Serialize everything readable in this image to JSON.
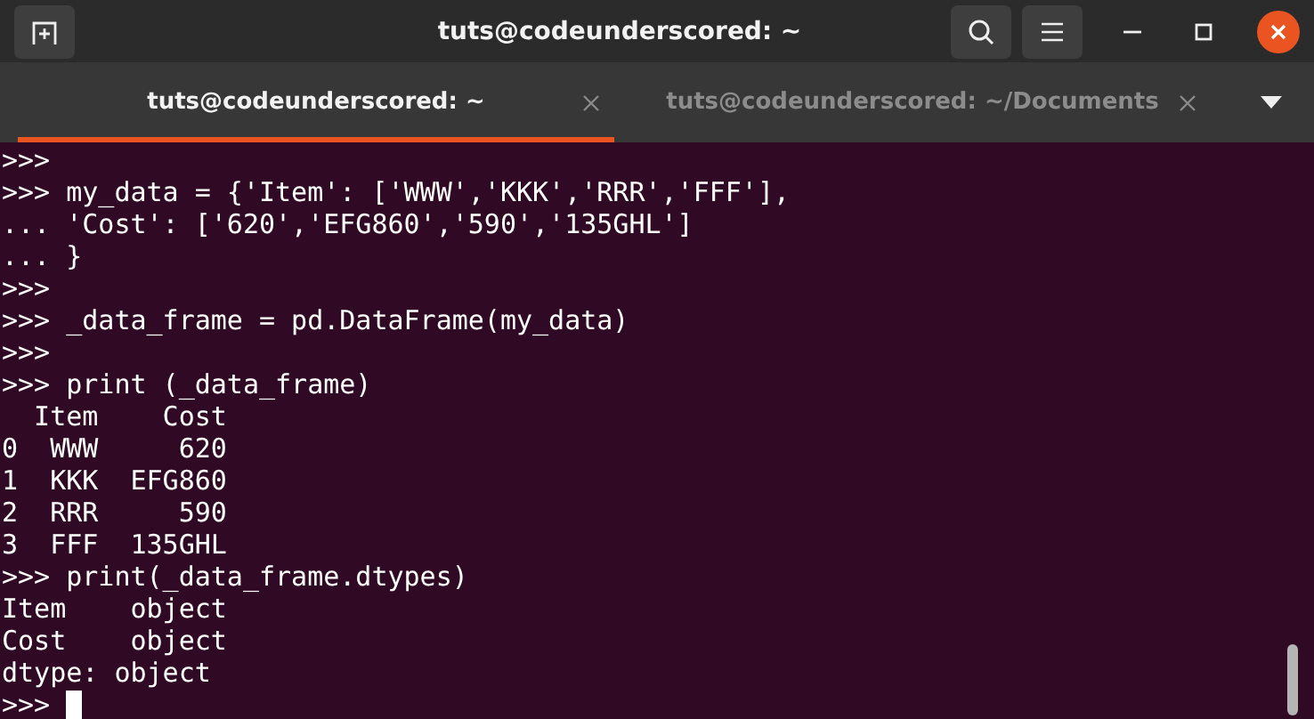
{
  "window": {
    "title": "tuts@codeunderscored: ~"
  },
  "tabs": [
    {
      "label": "tuts@codeunderscored: ~",
      "selected": true
    },
    {
      "label": "tuts@codeunderscored: ~/Documents",
      "selected": false
    }
  ],
  "terminal": {
    "lines": [
      ">>>",
      ">>> my_data = {'Item': ['WWW','KKK','RRR','FFF'],",
      "... 'Cost': ['620','EFG860','590','135GHL']",
      "... }",
      ">>>",
      ">>> _data_frame = pd.DataFrame(my_data)",
      ">>>",
      ">>> print (_data_frame)",
      "  Item    Cost",
      "0  WWW     620",
      "1  KKK  EFG860",
      "2  RRR     590",
      "3  FFF  135GHL",
      ">>> print(_data_frame.dtypes)",
      "Item    object",
      "Cost    object",
      "dtype: object",
      ">>> "
    ],
    "cursor": true
  }
}
